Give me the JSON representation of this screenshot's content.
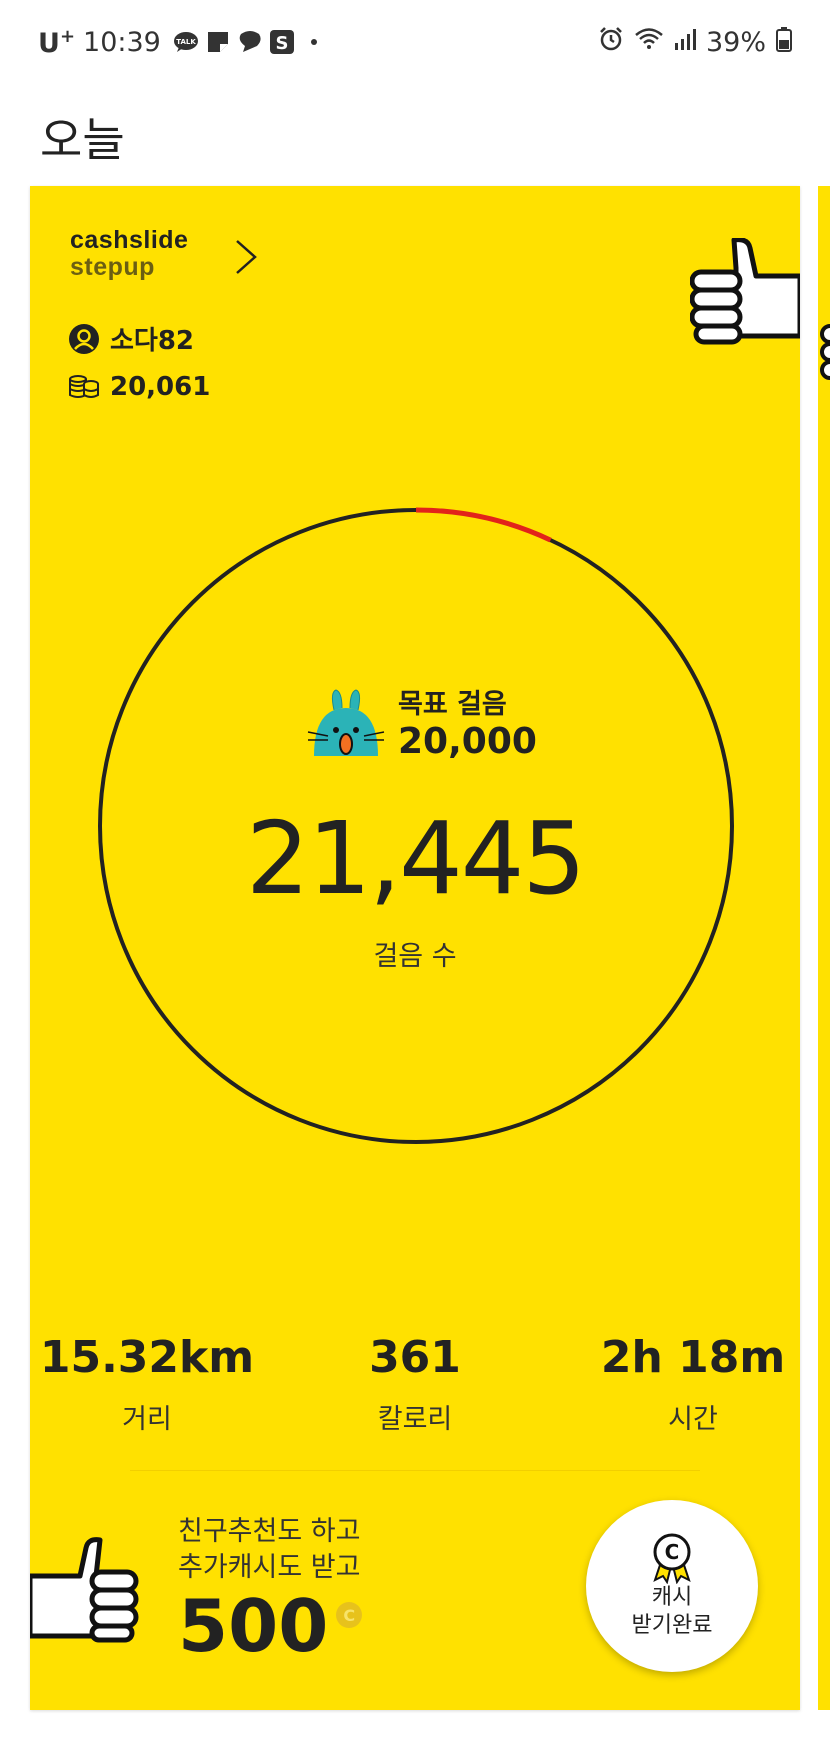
{
  "status_bar": {
    "carrier": "U",
    "carrier_sup": "+",
    "time": "10:39",
    "battery": "39%"
  },
  "page_title": "오늘",
  "card": {
    "brand_line1": "cashslide",
    "brand_line2": "stepup",
    "username": "소다82",
    "cash_balance": "20,061",
    "goal_label": "목표 걸음",
    "goal_value": "20,000",
    "steps": "21,445",
    "steps_label": "걸음 수",
    "stats": [
      {
        "value": "15.32km",
        "label": "거리"
      },
      {
        "value": "361",
        "label": "칼로리"
      },
      {
        "value": "2h 18m",
        "label": "시간"
      }
    ],
    "promo_line1": "친구추천도 하고",
    "promo_line2": "추가캐시도 받고",
    "promo_amount": "500",
    "coin_symbol": "C",
    "cash_button_line1": "캐시",
    "cash_button_line2": "받기완료",
    "goal_exceeded_fraction": 0.07
  },
  "colors": {
    "card_bg": "#ffe100",
    "ring": "#222222",
    "ring_progress": "#e2231a",
    "mascot": "#2bb3b7"
  }
}
